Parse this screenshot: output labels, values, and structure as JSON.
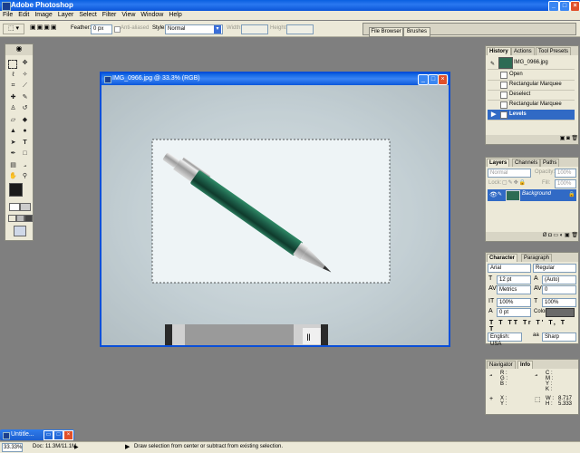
{
  "app": {
    "title": "Adobe Photoshop"
  },
  "menu": [
    "File",
    "Edit",
    "Image",
    "Layer",
    "Select",
    "Filter",
    "View",
    "Window",
    "Help"
  ],
  "options": {
    "feather_label": "Feather:",
    "feather_value": "0 px",
    "antialiased_label": "Anti-aliased",
    "style_label": "Style:",
    "style_value": "Normal",
    "width_label": "Width:",
    "height_label": "Height:",
    "file_browser": "File Browser",
    "brushes": "Brushes"
  },
  "document": {
    "title": "IMG_0966.jpg @ 33.3% (RGB)"
  },
  "history": {
    "tabs": [
      "History",
      "Actions",
      "Tool Presets"
    ],
    "snapshot": "IMG_0966.jpg",
    "items": [
      "Open",
      "Rectangular Marquee",
      "Deselect",
      "Rectangular Marquee",
      "Levels"
    ]
  },
  "layers": {
    "tabs": [
      "Layers",
      "Channels",
      "Paths"
    ],
    "blend": "Normal",
    "opacity_label": "Opacity:",
    "opacity": "100%",
    "lock_label": "Lock:",
    "fill_label": "Fill:",
    "fill": "100%",
    "layer_name": "Background"
  },
  "character": {
    "tabs": [
      "Character",
      "Paragraph"
    ],
    "font": "Arial",
    "style": "Regular",
    "size": "12 pt",
    "leading": "(Auto)",
    "kerning": "Metrics",
    "tracking": "0",
    "vscale": "100%",
    "hscale": "100%",
    "baseline": "0 pt",
    "color_label": "Color:",
    "language": "English: USA",
    "aa": "aa",
    "aa_mode": "Sharp"
  },
  "navigator": {
    "tabs": [
      "Navigator",
      "Info"
    ],
    "rgb": [
      "R :",
      "G :",
      "B :"
    ],
    "cmyk": [
      "C :",
      "M :",
      "Y :",
      "K :"
    ],
    "xy": [
      "X :",
      "Y :"
    ],
    "w_label": "W :",
    "h_label": "H :",
    "w": "8.717",
    "h": "5.333"
  },
  "taskbar": {
    "item": "Untitle..."
  },
  "status": {
    "zoom": "33.33%",
    "doc": "Doc: 11.3M/11.1M",
    "hint": "Draw selection from center or subtract from existing selection."
  }
}
